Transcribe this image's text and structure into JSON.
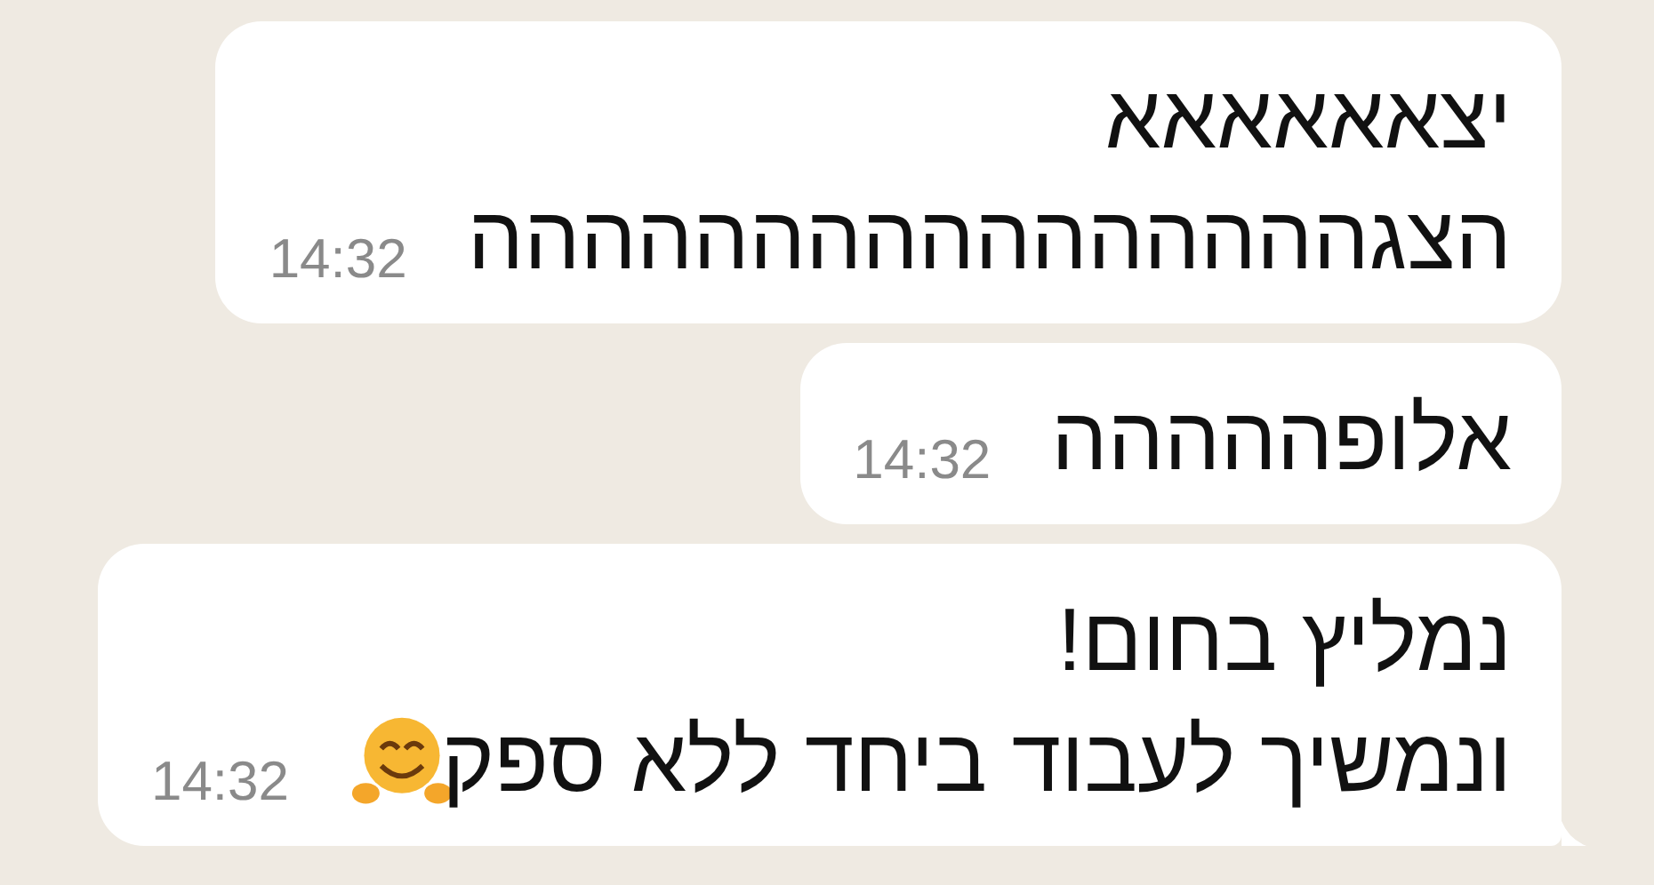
{
  "messages": [
    {
      "text": "יצאאאאאא\nהצגהההההההההההההההה",
      "time": "14:32",
      "emoji": false,
      "tail": false
    },
    {
      "text": "אלופההההה",
      "time": "14:32",
      "emoji": false,
      "tail": false
    },
    {
      "text": "נמליץ בחום!\nונמשיך לעבוד ביחד ללא ספק",
      "time": "14:32",
      "emoji": true,
      "tail": true
    }
  ]
}
